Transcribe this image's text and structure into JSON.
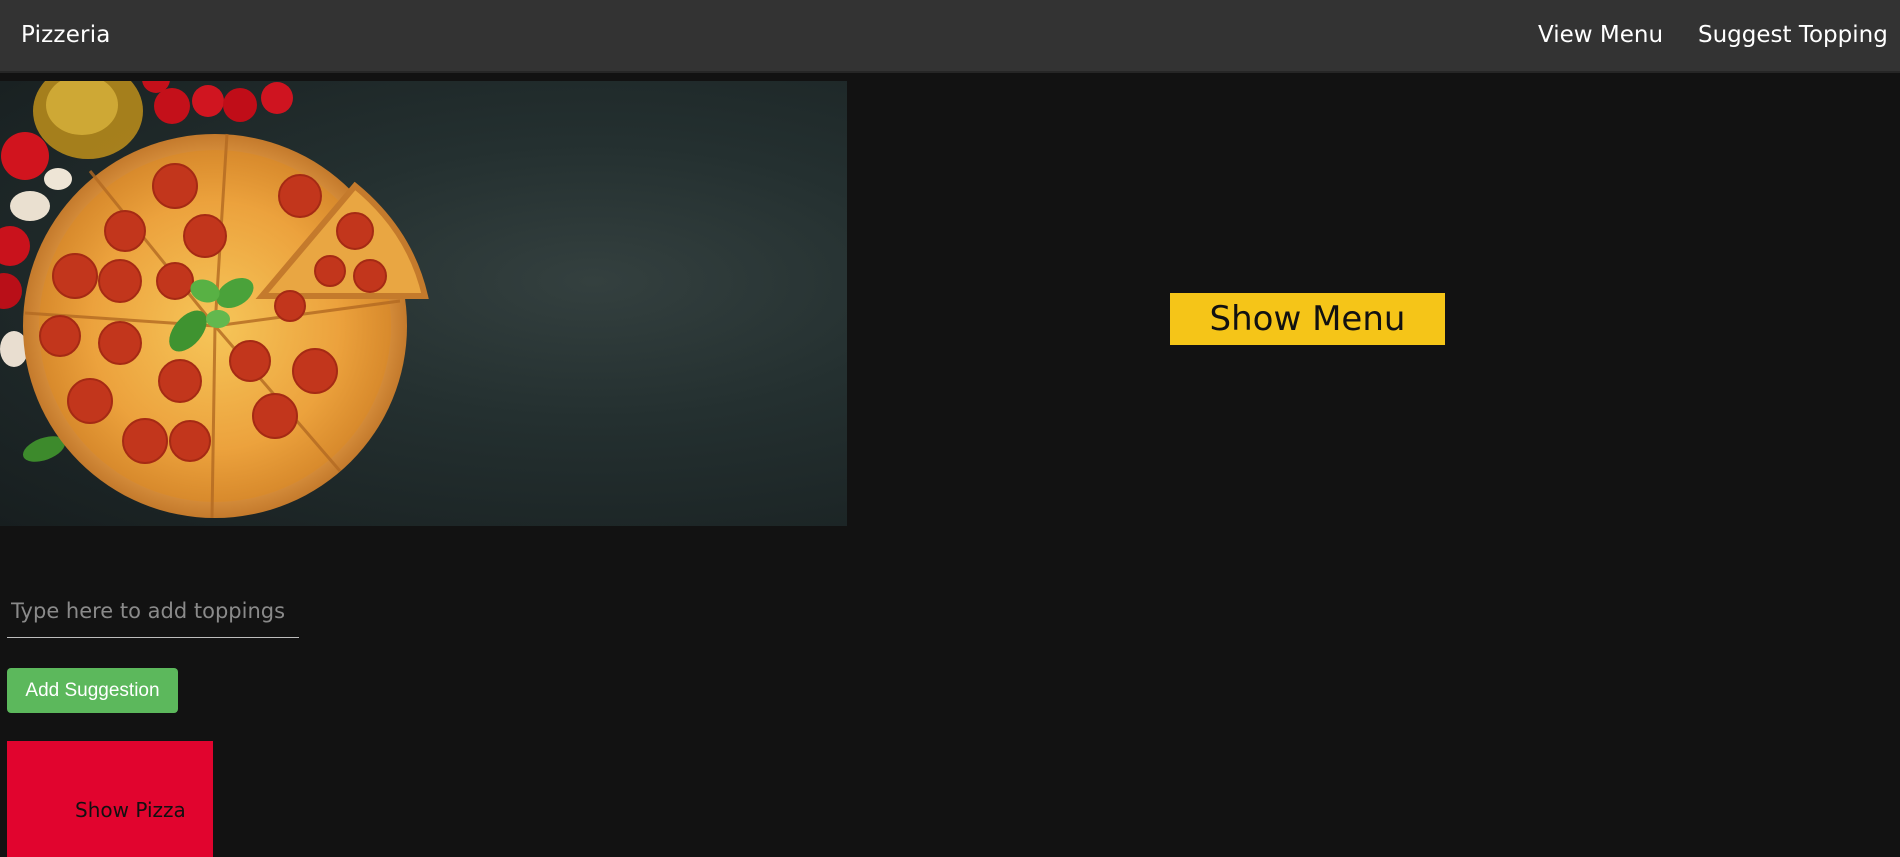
{
  "navbar": {
    "brand": "Pizzeria",
    "links": [
      {
        "label": "View Menu"
      },
      {
        "label": "Suggest Topping"
      }
    ]
  },
  "hero": {
    "image": "pepperoni-pizza-photo"
  },
  "menu": {
    "show_label": "Show Menu"
  },
  "suggest": {
    "placeholder": "Type here to add toppings",
    "value": "",
    "add_label": "Add Suggestion"
  },
  "pizza": {
    "show_label": "Show Pizza"
  },
  "colors": {
    "background": "#121212",
    "navbar": "#333333",
    "show_menu": "#f5c518",
    "add_button": "#5cb85c",
    "show_pizza": "#e1042e"
  }
}
